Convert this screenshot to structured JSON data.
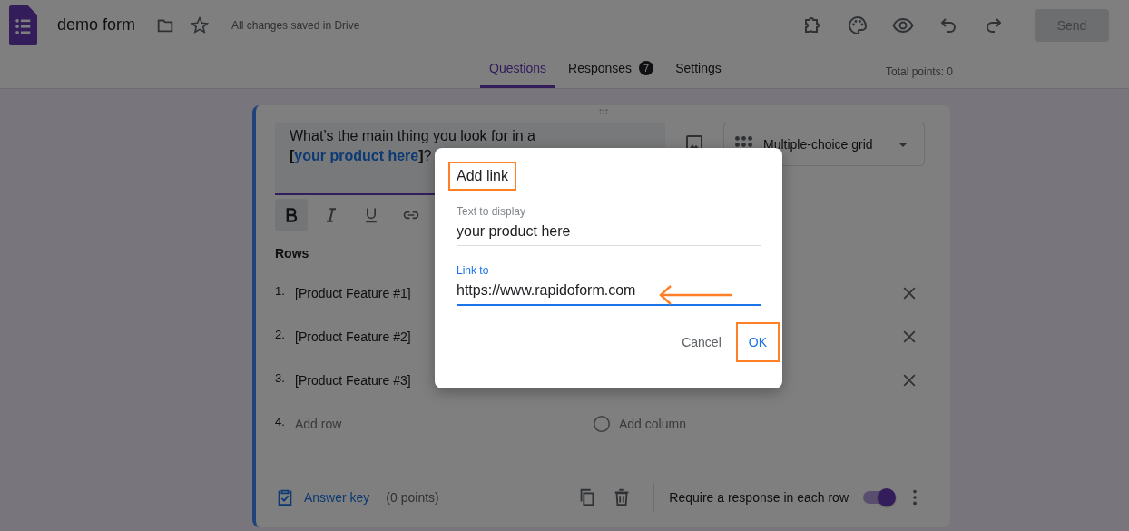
{
  "header": {
    "form_title": "demo form",
    "save_status": "All changes saved in Drive",
    "send_button": "Send"
  },
  "tabs": [
    {
      "label": "Questions",
      "selected": true
    },
    {
      "label": "Responses",
      "selected": false,
      "badge": "7"
    },
    {
      "label": "Settings",
      "selected": false
    }
  ],
  "total_points": "Total points: 0",
  "question": {
    "parts": [
      {
        "kind": "plain",
        "text": "What’s the main thing you look for in a "
      },
      {
        "kind": "bold",
        "text": "["
      },
      {
        "kind": "link",
        "text": "your product here"
      },
      {
        "kind": "bold",
        "text": "]"
      },
      {
        "kind": "plain",
        "text": "?"
      }
    ],
    "type": "Multiple-choice grid"
  },
  "format_toolbar": [
    {
      "kind": "bold",
      "selected": true
    },
    {
      "kind": "italic",
      "selected": false
    },
    {
      "kind": "underline",
      "selected": false
    },
    {
      "kind": "link",
      "selected": false
    }
  ],
  "rows_label": "Rows",
  "rows": [
    {
      "number": "1.",
      "text": "[Product Feature #1]"
    },
    {
      "number": "2.",
      "text": "[Product Feature #2]"
    },
    {
      "number": "3.",
      "text": "[Product Feature #3]"
    }
  ],
  "add_row": {
    "number": "4.",
    "placeholder": "Add row"
  },
  "add_column": {
    "placeholder": "Add column"
  },
  "footer": {
    "answer_key": "Answer key",
    "points": "(0 points)",
    "require_label": "Require a response in each row",
    "require_on": true
  },
  "dialog": {
    "title": "Add link",
    "title_highlighted": true,
    "fields": [
      {
        "label": "Text to display",
        "value": "your product here",
        "focused": false
      },
      {
        "label": "Link to",
        "value": "https://www.rapidoform.com",
        "focused": true,
        "arrow": true
      }
    ],
    "cancel": "Cancel",
    "ok": "OK",
    "ok_highlighted": true
  }
}
